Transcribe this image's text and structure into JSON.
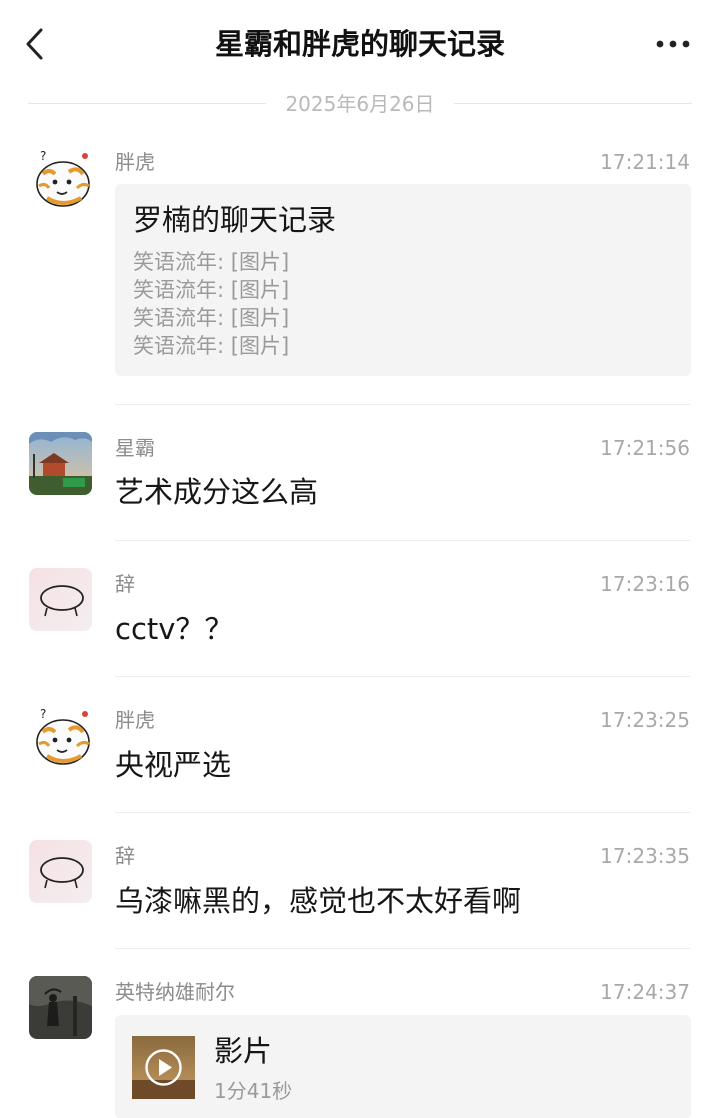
{
  "header": {
    "title": "星霸和胖虎的聊天记录"
  },
  "date_divider": "2025年6月26日",
  "messages": [
    {
      "sender": "胖虎",
      "time": "17:21:14",
      "avatar": "tiger-avatar",
      "record_card": {
        "title": "罗楠的聊天记录",
        "lines": [
          "笑语流年: [图片]",
          "笑语流年: [图片]",
          "笑语流年: [图片]",
          "笑语流年: [图片]"
        ]
      }
    },
    {
      "sender": "星霸",
      "time": "17:21:56",
      "avatar": "landscape-avatar",
      "text": "艺术成分这么高"
    },
    {
      "sender": "辞",
      "time": "17:23:16",
      "avatar": "doodle-avatar",
      "text": "cctv？？"
    },
    {
      "sender": "胖虎",
      "time": "17:23:25",
      "avatar": "tiger-avatar",
      "text": "央视严选"
    },
    {
      "sender": "辞",
      "time": "17:23:35",
      "avatar": "doodle-avatar",
      "text": "乌漆嘛黑的，感觉也不太好看啊"
    },
    {
      "sender": "英特纳雄耐尔",
      "time": "17:24:37",
      "avatar": "dark-figure-avatar",
      "video_card": {
        "title": "影片",
        "duration": "1分41秒"
      }
    }
  ]
}
